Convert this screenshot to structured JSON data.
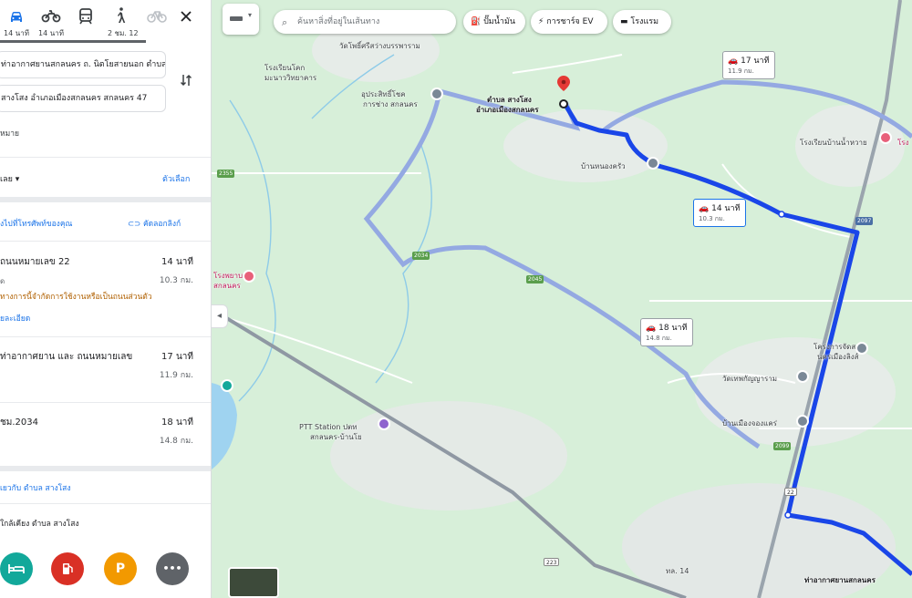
{
  "panel": {
    "modes": [
      {
        "name": "car",
        "label": "14 นาที",
        "active": true
      },
      {
        "name": "motorcycle",
        "label": "14 นาที",
        "active": false
      },
      {
        "name": "transit",
        "label": "",
        "active": false
      },
      {
        "name": "walk",
        "label": "2 ชม. 12",
        "active": false
      },
      {
        "name": "bicycle",
        "label": "",
        "active": false
      }
    ],
    "origin_value": "ท่าอากาศยานสกลนคร ถ. นิตโยสายนอก ตำบล",
    "destination_value": "สางโสง อำเภอเมืองสกลนคร สกลนคร 47",
    "add_stop": "หมาย",
    "depart_label": "เลย",
    "options_label": "ตัวเลือก",
    "send_to_phone": "งไปที่โทรศัพท์ของคุณ",
    "copy_link": "คัดลอกลิงก์",
    "routes": [
      {
        "name": "ถนนหมายเลข 22",
        "time": "14 นาที",
        "distance": "10.3 กม.",
        "sub": "ด",
        "warning": "ทางการนี้จำกัดการใช้งานหรือเป็นถนนส่วนตัว",
        "details": "ยละเอียด"
      },
      {
        "name": "ท่าอากาศยาน และ ถนนหมายเลข",
        "time": "17 นาที",
        "distance": "11.9 กม."
      },
      {
        "name": "ชม.2034",
        "time": "18 นาที",
        "distance": "14.8 กม."
      }
    ],
    "explore_label": "เยวกับ ตำบล สางโสง",
    "nearby_label": "ใกล้เคียง ตำบล สางโสง",
    "quick_actions": [
      {
        "name": "hotel",
        "symbol": "",
        "color": "#12a89a"
      },
      {
        "name": "gas",
        "symbol": "",
        "color": "#d93025"
      },
      {
        "name": "parking",
        "symbol": "P",
        "color": "#f29900"
      },
      {
        "name": "more",
        "symbol": "•••",
        "color": "#5f6368"
      }
    ]
  },
  "map": {
    "search_placeholder": "ค้นหาสิ่งที่อยู่ในเส้นทาง",
    "chips": [
      {
        "name": "gas",
        "label": "ปั๊มน้ำมัน"
      },
      {
        "name": "ev",
        "label": "การชาร์จ EV"
      },
      {
        "name": "hotel",
        "label": "โรงแรม"
      }
    ],
    "callouts": [
      {
        "name": "route-17",
        "time": "17 นาที",
        "distance": "11.9 กม."
      },
      {
        "name": "route-14",
        "time": "14 นาที",
        "distance": "10.3 กม."
      },
      {
        "name": "route-18",
        "time": "18 นาที",
        "distance": "14.8 กม."
      }
    ],
    "destination_label_1": "ตำบล สางโสง",
    "destination_label_2": "อำเภอเมืองสกลนคร",
    "origin_label": "ท่าอากาศยานสกลนคร",
    "place_labels": {
      "temple_top": "วัดโพธิ์ศรีสว่างบรรพาราม",
      "school_left_1": "โรงเรียนโคก",
      "school_left_2": "มะนาววิทยาคาร",
      "uprasit_1": "อุประสิทธิ์โชค",
      "uprasit_2": "การช่าง สกลนคร",
      "village_nongkrua": "บ้านหนองครัว",
      "school_right": "โรงเรียนบ้านน้ำหวาย",
      "hotel_right": "โรง",
      "hospital_1": "โรงพยาบาล",
      "hospital_2": "สกลนคร",
      "project_1": "โครงการจัดสรร",
      "project_2": "นครเมืองลิงส์",
      "temple_right": "วัดเทพกัญญาราม",
      "village_right": "บ้านเมืองจองแคร่",
      "ptt_1": "PTT Station ปตท",
      "ptt_2": "สกลนคร-บ้านโย",
      "road_14": "ทล. 14",
      "shield_2355": "2355",
      "shield_2034": "2034",
      "shield_2045": "2045",
      "shield_2099": "2099",
      "shield_22": "22",
      "shield_223": "223",
      "shield_2097": "2097"
    }
  }
}
